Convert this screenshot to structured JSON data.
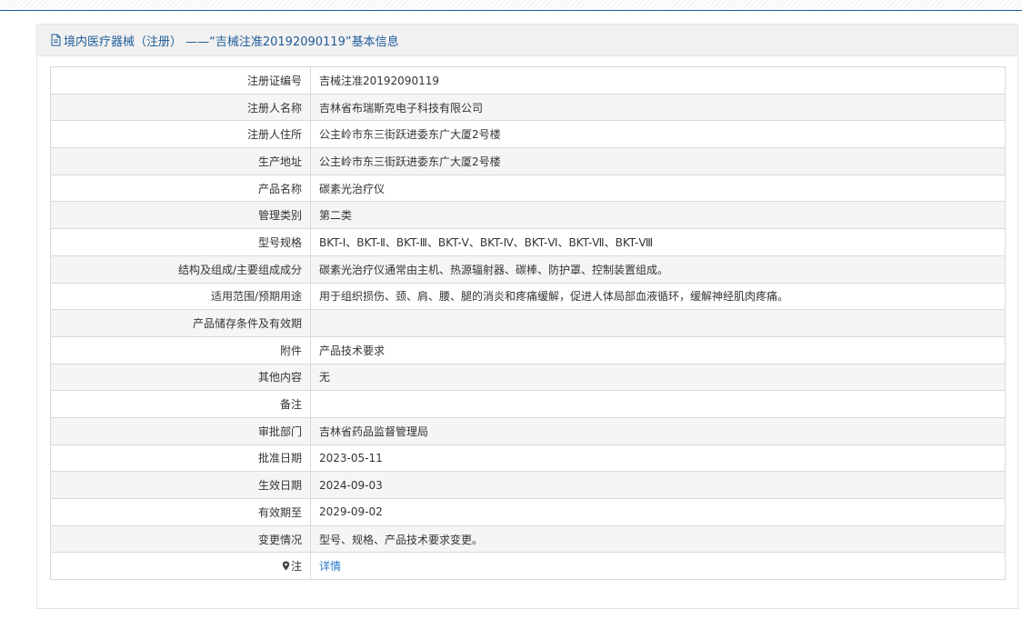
{
  "header": {
    "title": "境内医疗器械（注册） ——“吉械注准20192090119”基本信息"
  },
  "rows": [
    {
      "label": "注册证编号",
      "value": "吉械注准20192090119"
    },
    {
      "label": "注册人名称",
      "value": "吉林省布瑞斯克电子科技有限公司"
    },
    {
      "label": "注册人住所",
      "value": "公主岭市东三街跃进委东广大厦2号楼"
    },
    {
      "label": "生产地址",
      "value": "公主岭市东三街跃进委东广大厦2号楼"
    },
    {
      "label": "产品名称",
      "value": "碳素光治疗仪"
    },
    {
      "label": "管理类别",
      "value": "第二类"
    },
    {
      "label": "型号规格",
      "value": "BKT-Ⅰ、BKT-Ⅱ、BKT-Ⅲ、BKT-Ⅴ、BKT-Ⅳ、BKT-Ⅵ、BKT-Ⅶ、BKT-Ⅷ"
    },
    {
      "label": "结构及组成/主要组成成分",
      "value": "碳素光治疗仪通常由主机、热源辐射器、碳棒、防护罩、控制装置组成。"
    },
    {
      "label": "适用范围/预期用途",
      "value": "用于组织损伤、颈、肩、腰、腿的消炎和疼痛缓解，促进人体局部血液循环，缓解神经肌肉疼痛。"
    },
    {
      "label": "产品储存条件及有效期",
      "value": ""
    },
    {
      "label": "附件",
      "value": "产品技术要求"
    },
    {
      "label": "其他内容",
      "value": "无"
    },
    {
      "label": "备注",
      "value": ""
    },
    {
      "label": "审批部门",
      "value": "吉林省药品监督管理局"
    },
    {
      "label": "批准日期",
      "value": "2023-05-11"
    },
    {
      "label": "生效日期",
      "value": "2024-09-03"
    },
    {
      "label": "有效期至",
      "value": "2029-09-02"
    },
    {
      "label": "变更情况",
      "value": "型号、规格、产品技术要求变更。"
    },
    {
      "label": "注",
      "value": "详情"
    }
  ],
  "colors": {
    "accent": "#1f5c99",
    "link": "#2a77c9",
    "stripe": "#f5f5f5"
  },
  "icons": {
    "header": "document-icon",
    "note": "pin-icon"
  }
}
